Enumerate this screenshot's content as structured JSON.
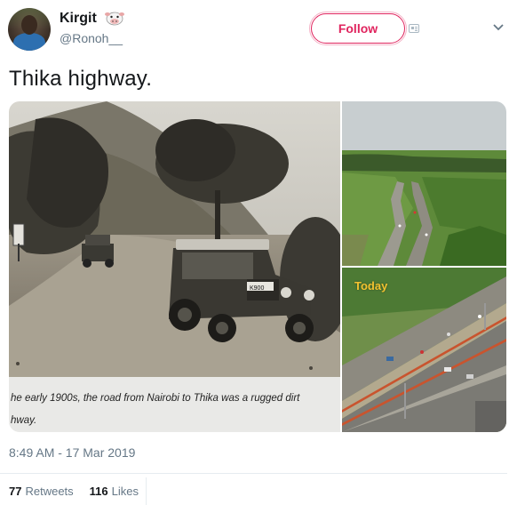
{
  "user": {
    "name": "Kirgit",
    "handle": "@Ronoh__"
  },
  "follow_label": "Follow",
  "tweet": {
    "text": "Thika highway.",
    "timestamp": "8:49 AM - 17 Mar 2019"
  },
  "media": {
    "caption_line1": "he early 1900s, the road from Nairobi to Thika was a rugged dirt",
    "caption_line2": "hway.",
    "today_label": "Today",
    "car_plate": "K900"
  },
  "stats": {
    "retweets_count": "77",
    "retweets_label": "Retweets",
    "likes_count": "116",
    "likes_label": "Likes"
  },
  "colors": {
    "follow_accent": "#e0245e",
    "secondary_text": "#657786",
    "today_label": "#f2c230"
  }
}
